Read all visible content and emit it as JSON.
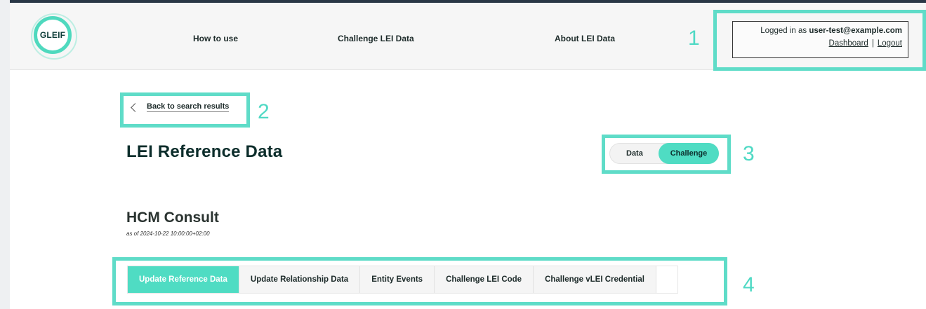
{
  "header": {
    "logo_text": "GLEIF",
    "nav": [
      {
        "label": "How to use"
      },
      {
        "label": "Challenge LEI Data"
      },
      {
        "label": "About LEI Data"
      }
    ],
    "login": {
      "prefix": "Logged in as",
      "user": "user-test@example.com",
      "dashboard": "Dashboard",
      "separator": "|",
      "logout": "Logout"
    }
  },
  "back": {
    "label": "Back to search results"
  },
  "page": {
    "title": "LEI Reference Data",
    "toggle": {
      "data": "Data",
      "challenge": "Challenge",
      "selected": "Challenge"
    }
  },
  "entity": {
    "name": "HCM Consult",
    "as_of": "as of 2024-10-22 10:00:00+02:00"
  },
  "tabs": [
    {
      "label": "Update Reference Data",
      "active": true
    },
    {
      "label": "Update Relationship Data",
      "active": false
    },
    {
      "label": "Entity Events",
      "active": false
    },
    {
      "label": "Challenge LEI Code",
      "active": false
    },
    {
      "label": "Challenge vLEI Credential",
      "active": false
    }
  ],
  "annotations": [
    "1",
    "2",
    "3",
    "4"
  ],
  "colors": {
    "accent": "#4fdcc3",
    "annotation": "#5fdcc8",
    "dark_text": "#0c2d2b",
    "top_bar": "#2a3746"
  }
}
